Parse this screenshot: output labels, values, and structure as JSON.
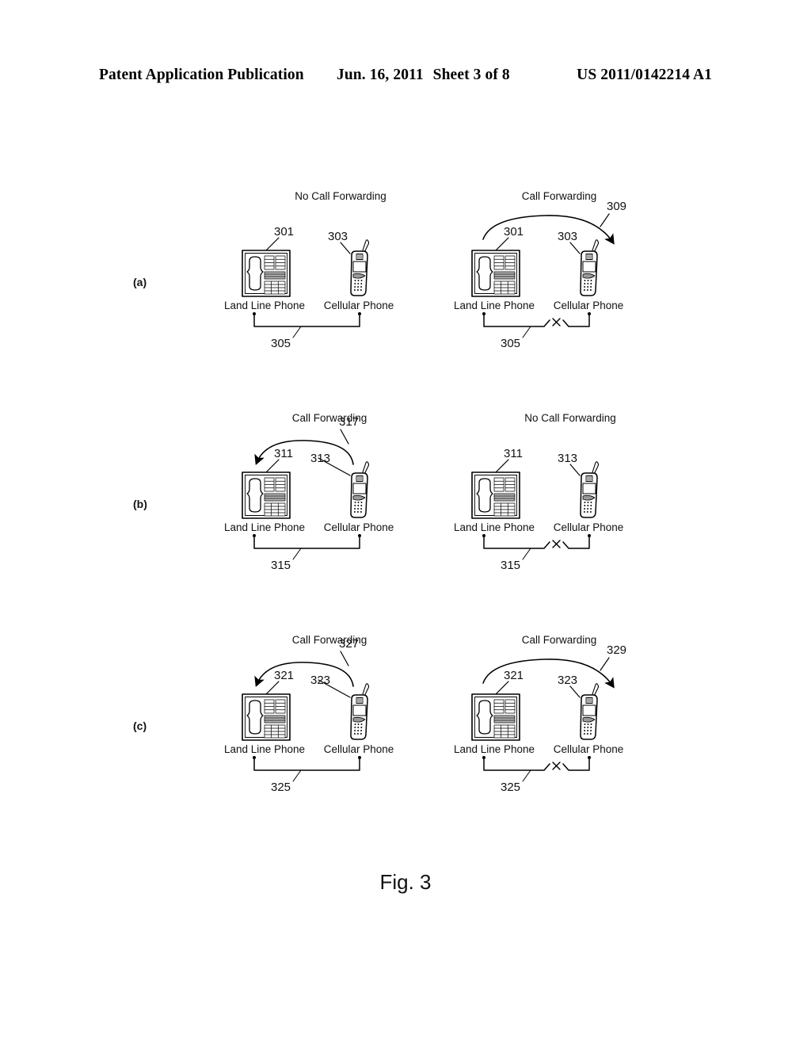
{
  "header": {
    "publication": "Patent Application Publication",
    "date": "Jun. 16, 2011",
    "sheet": "Sheet 3 of 8",
    "patent_number": "US 2011/0142214 A1"
  },
  "figure": {
    "caption": "Fig. 3",
    "rows": [
      {
        "label": "(a)"
      },
      {
        "label": "(b)"
      },
      {
        "label": "(c)"
      }
    ]
  },
  "labels": {
    "land_line_phone": "Land Line Phone",
    "cellular_phone": "Cellular Phone",
    "call_forwarding": "Call Forwarding",
    "no_call_forwarding": "No Call Forwarding"
  },
  "panels": {
    "a_left": {
      "title": "No Call Forwarding",
      "landline_ref": "301",
      "cellular_ref": "303",
      "link_ref": "305",
      "landline_caption": "Land Line Phone",
      "cellular_caption": "Cellular Phone",
      "forwarding": "none",
      "link_broken": false
    },
    "a_right": {
      "title": "Call Forwarding",
      "arrow_ref": "309",
      "landline_ref": "301",
      "cellular_ref": "303",
      "link_ref": "305",
      "landline_caption": "Land Line Phone",
      "cellular_caption": "Cellular Phone",
      "forwarding": "to-cellular",
      "link_broken": true
    },
    "b_left": {
      "title": "Call Forwarding",
      "arrow_ref": "317",
      "landline_ref": "311",
      "cellular_ref": "313",
      "link_ref": "315",
      "landline_caption": "Land Line Phone",
      "cellular_caption": "Cellular Phone",
      "forwarding": "to-landline",
      "link_broken": false
    },
    "b_right": {
      "title": "No Call Forwarding",
      "landline_ref": "311",
      "cellular_ref": "313",
      "link_ref": "315",
      "landline_caption": "Land Line Phone",
      "cellular_caption": "Cellular Phone",
      "forwarding": "none",
      "link_broken": true
    },
    "c_left": {
      "title": "Call Forwarding",
      "arrow_ref": "327",
      "landline_ref": "321",
      "cellular_ref": "323",
      "link_ref": "325",
      "landline_caption": "Land Line Phone",
      "cellular_caption": "Cellular Phone",
      "forwarding": "to-landline",
      "link_broken": false
    },
    "c_right": {
      "title": "Call Forwarding",
      "arrow_ref": "329",
      "landline_ref": "321",
      "cellular_ref": "323",
      "link_ref": "325",
      "landline_caption": "Land Line Phone",
      "cellular_caption": "Cellular Phone",
      "forwarding": "to-cellular",
      "link_broken": true
    }
  },
  "colors": {
    "ink": "#000000",
    "paper": "#ffffff"
  }
}
